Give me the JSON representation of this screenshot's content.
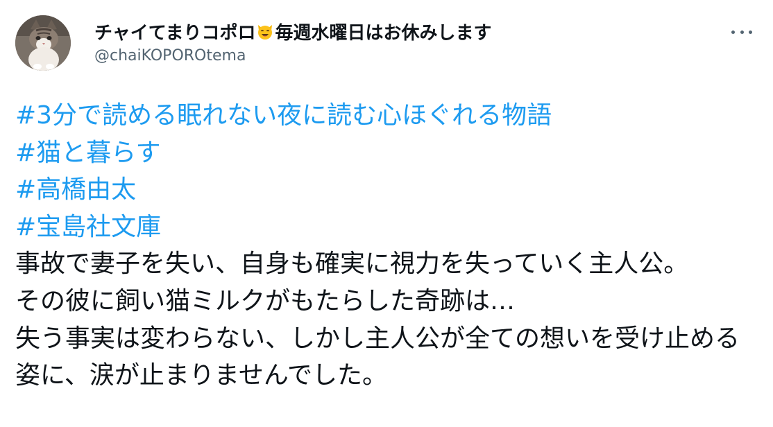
{
  "user": {
    "display_name_part1": "チャイてまりコポロ",
    "display_name_emoji": "smiling-cat-face-emoji",
    "display_name_part2": "毎週水曜日はお休みします",
    "handle": "@chaiKOPOROtema",
    "avatar": "cat-photo-avatar"
  },
  "menu": {
    "icon": "more-horizontal-icon"
  },
  "tweet": {
    "hashtags": [
      "#3分で読める眠れない夜に読む心ほぐれる物語",
      "#猫と暮らす",
      "#高橋由太",
      "#宝島社文庫"
    ],
    "paragraphs": [
      "事故で妻子を失い、自身も確実に視力を失っていく主人公。",
      "その彼に飼い猫ミルクがもたらした奇跡は…",
      "失う事実は変わらない、しかし主人公が全ての想いを受け止める姿に、涙が止まりませんでした。"
    ]
  },
  "colors": {
    "link": "#1d9bf0",
    "text": "#0f1419",
    "secondary": "#536471"
  }
}
